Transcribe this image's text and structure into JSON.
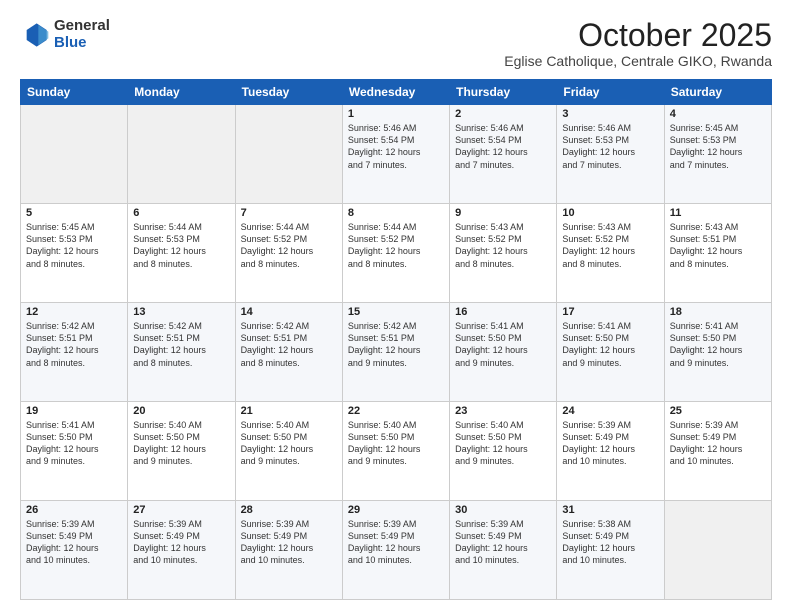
{
  "header": {
    "logo_general": "General",
    "logo_blue": "Blue",
    "month_title": "October 2025",
    "subtitle": "Eglise Catholique, Centrale GIKO, Rwanda"
  },
  "days_of_week": [
    "Sunday",
    "Monday",
    "Tuesday",
    "Wednesday",
    "Thursday",
    "Friday",
    "Saturday"
  ],
  "weeks": [
    [
      {
        "day": "",
        "lines": []
      },
      {
        "day": "",
        "lines": []
      },
      {
        "day": "",
        "lines": []
      },
      {
        "day": "1",
        "lines": [
          "Sunrise: 5:46 AM",
          "Sunset: 5:54 PM",
          "Daylight: 12 hours",
          "and 7 minutes."
        ]
      },
      {
        "day": "2",
        "lines": [
          "Sunrise: 5:46 AM",
          "Sunset: 5:54 PM",
          "Daylight: 12 hours",
          "and 7 minutes."
        ]
      },
      {
        "day": "3",
        "lines": [
          "Sunrise: 5:46 AM",
          "Sunset: 5:53 PM",
          "Daylight: 12 hours",
          "and 7 minutes."
        ]
      },
      {
        "day": "4",
        "lines": [
          "Sunrise: 5:45 AM",
          "Sunset: 5:53 PM",
          "Daylight: 12 hours",
          "and 7 minutes."
        ]
      }
    ],
    [
      {
        "day": "5",
        "lines": [
          "Sunrise: 5:45 AM",
          "Sunset: 5:53 PM",
          "Daylight: 12 hours",
          "and 8 minutes."
        ]
      },
      {
        "day": "6",
        "lines": [
          "Sunrise: 5:44 AM",
          "Sunset: 5:53 PM",
          "Daylight: 12 hours",
          "and 8 minutes."
        ]
      },
      {
        "day": "7",
        "lines": [
          "Sunrise: 5:44 AM",
          "Sunset: 5:52 PM",
          "Daylight: 12 hours",
          "and 8 minutes."
        ]
      },
      {
        "day": "8",
        "lines": [
          "Sunrise: 5:44 AM",
          "Sunset: 5:52 PM",
          "Daylight: 12 hours",
          "and 8 minutes."
        ]
      },
      {
        "day": "9",
        "lines": [
          "Sunrise: 5:43 AM",
          "Sunset: 5:52 PM",
          "Daylight: 12 hours",
          "and 8 minutes."
        ]
      },
      {
        "day": "10",
        "lines": [
          "Sunrise: 5:43 AM",
          "Sunset: 5:52 PM",
          "Daylight: 12 hours",
          "and 8 minutes."
        ]
      },
      {
        "day": "11",
        "lines": [
          "Sunrise: 5:43 AM",
          "Sunset: 5:51 PM",
          "Daylight: 12 hours",
          "and 8 minutes."
        ]
      }
    ],
    [
      {
        "day": "12",
        "lines": [
          "Sunrise: 5:42 AM",
          "Sunset: 5:51 PM",
          "Daylight: 12 hours",
          "and 8 minutes."
        ]
      },
      {
        "day": "13",
        "lines": [
          "Sunrise: 5:42 AM",
          "Sunset: 5:51 PM",
          "Daylight: 12 hours",
          "and 8 minutes."
        ]
      },
      {
        "day": "14",
        "lines": [
          "Sunrise: 5:42 AM",
          "Sunset: 5:51 PM",
          "Daylight: 12 hours",
          "and 8 minutes."
        ]
      },
      {
        "day": "15",
        "lines": [
          "Sunrise: 5:42 AM",
          "Sunset: 5:51 PM",
          "Daylight: 12 hours",
          "and 9 minutes."
        ]
      },
      {
        "day": "16",
        "lines": [
          "Sunrise: 5:41 AM",
          "Sunset: 5:50 PM",
          "Daylight: 12 hours",
          "and 9 minutes."
        ]
      },
      {
        "day": "17",
        "lines": [
          "Sunrise: 5:41 AM",
          "Sunset: 5:50 PM",
          "Daylight: 12 hours",
          "and 9 minutes."
        ]
      },
      {
        "day": "18",
        "lines": [
          "Sunrise: 5:41 AM",
          "Sunset: 5:50 PM",
          "Daylight: 12 hours",
          "and 9 minutes."
        ]
      }
    ],
    [
      {
        "day": "19",
        "lines": [
          "Sunrise: 5:41 AM",
          "Sunset: 5:50 PM",
          "Daylight: 12 hours",
          "and 9 minutes."
        ]
      },
      {
        "day": "20",
        "lines": [
          "Sunrise: 5:40 AM",
          "Sunset: 5:50 PM",
          "Daylight: 12 hours",
          "and 9 minutes."
        ]
      },
      {
        "day": "21",
        "lines": [
          "Sunrise: 5:40 AM",
          "Sunset: 5:50 PM",
          "Daylight: 12 hours",
          "and 9 minutes."
        ]
      },
      {
        "day": "22",
        "lines": [
          "Sunrise: 5:40 AM",
          "Sunset: 5:50 PM",
          "Daylight: 12 hours",
          "and 9 minutes."
        ]
      },
      {
        "day": "23",
        "lines": [
          "Sunrise: 5:40 AM",
          "Sunset: 5:50 PM",
          "Daylight: 12 hours",
          "and 9 minutes."
        ]
      },
      {
        "day": "24",
        "lines": [
          "Sunrise: 5:39 AM",
          "Sunset: 5:49 PM",
          "Daylight: 12 hours",
          "and 10 minutes."
        ]
      },
      {
        "day": "25",
        "lines": [
          "Sunrise: 5:39 AM",
          "Sunset: 5:49 PM",
          "Daylight: 12 hours",
          "and 10 minutes."
        ]
      }
    ],
    [
      {
        "day": "26",
        "lines": [
          "Sunrise: 5:39 AM",
          "Sunset: 5:49 PM",
          "Daylight: 12 hours",
          "and 10 minutes."
        ]
      },
      {
        "day": "27",
        "lines": [
          "Sunrise: 5:39 AM",
          "Sunset: 5:49 PM",
          "Daylight: 12 hours",
          "and 10 minutes."
        ]
      },
      {
        "day": "28",
        "lines": [
          "Sunrise: 5:39 AM",
          "Sunset: 5:49 PM",
          "Daylight: 12 hours",
          "and 10 minutes."
        ]
      },
      {
        "day": "29",
        "lines": [
          "Sunrise: 5:39 AM",
          "Sunset: 5:49 PM",
          "Daylight: 12 hours",
          "and 10 minutes."
        ]
      },
      {
        "day": "30",
        "lines": [
          "Sunrise: 5:39 AM",
          "Sunset: 5:49 PM",
          "Daylight: 12 hours",
          "and 10 minutes."
        ]
      },
      {
        "day": "31",
        "lines": [
          "Sunrise: 5:38 AM",
          "Sunset: 5:49 PM",
          "Daylight: 12 hours",
          "and 10 minutes."
        ]
      },
      {
        "day": "",
        "lines": []
      }
    ]
  ]
}
